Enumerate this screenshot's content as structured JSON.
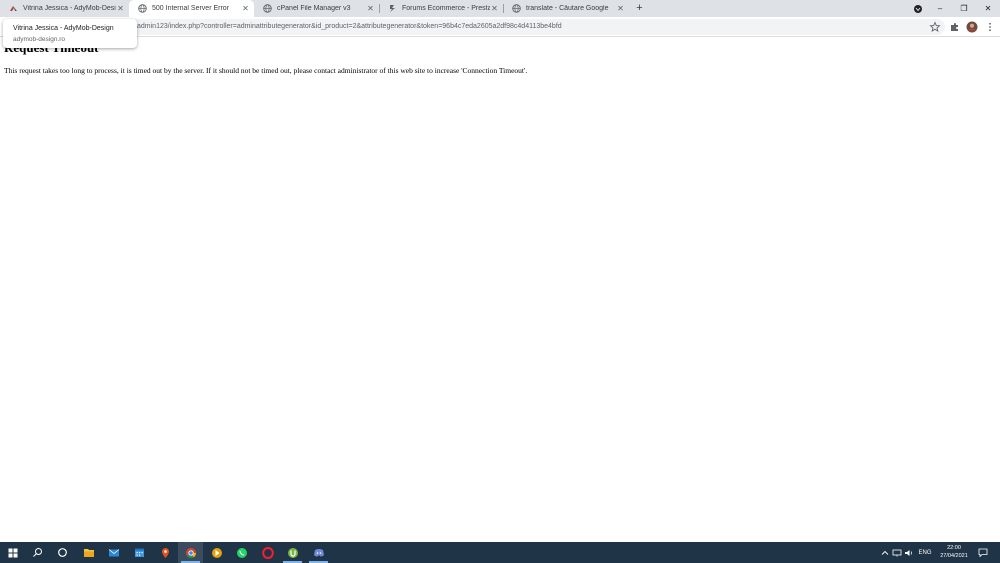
{
  "browser": {
    "tabs": [
      {
        "title": "Vitrina Jessica - AdyMob-Design",
        "favicon": "adymob-favicon",
        "active": false
      },
      {
        "title": "500 Internal Server Error",
        "favicon": "globe-icon",
        "active": true
      },
      {
        "title": "cPanel File Manager v3",
        "favicon": "globe-icon",
        "active": false
      },
      {
        "title": "Forums Ecommerce - PrestaShop",
        "favicon": "prestashop-favicon",
        "active": false
      },
      {
        "title": "translate - Căutare Google",
        "favicon": "globe-icon",
        "active": false
      }
    ],
    "new_tab_label": "+",
    "window_controls": {
      "minimize": "–",
      "restore": "❐",
      "close": "✕"
    },
    "address_bar": {
      "url": "admin123/index.php?controller=adminattributegenerator&id_product=2&attributegenerator&token=96b4c7eda2605a2df98c4d4113be4bfd"
    },
    "hover_card": {
      "title": "Vitrina Jessica - AdyMob-Design",
      "url": "adymob-design.ro"
    }
  },
  "page": {
    "heading": "Request Timeout",
    "message": "This request takes too long to process, it is timed out by the server. If it should not be timed out, please contact administrator of this web site to increase 'Connection Timeout'."
  },
  "taskbar": {
    "apps": [
      {
        "name": "windows-start-icon"
      },
      {
        "name": "search-icon"
      },
      {
        "name": "cortana-icon"
      },
      {
        "name": "file-explorer-icon"
      },
      {
        "name": "mail-icon"
      },
      {
        "name": "calendar-icon"
      },
      {
        "name": "maps-icon"
      },
      {
        "name": "chrome-icon"
      },
      {
        "name": "plex-icon"
      },
      {
        "name": "whatsapp-icon"
      },
      {
        "name": "opera-icon"
      },
      {
        "name": "utorrent-icon"
      },
      {
        "name": "discord-icon"
      }
    ],
    "tray": {
      "language": "ENG",
      "time": "22:00",
      "date": "27/04/2021"
    }
  },
  "colors": {
    "tabstrip_bg": "#dee1e6",
    "taskbar_bg": "#1f3447",
    "omnibox_bg": "#f1f3f4"
  }
}
